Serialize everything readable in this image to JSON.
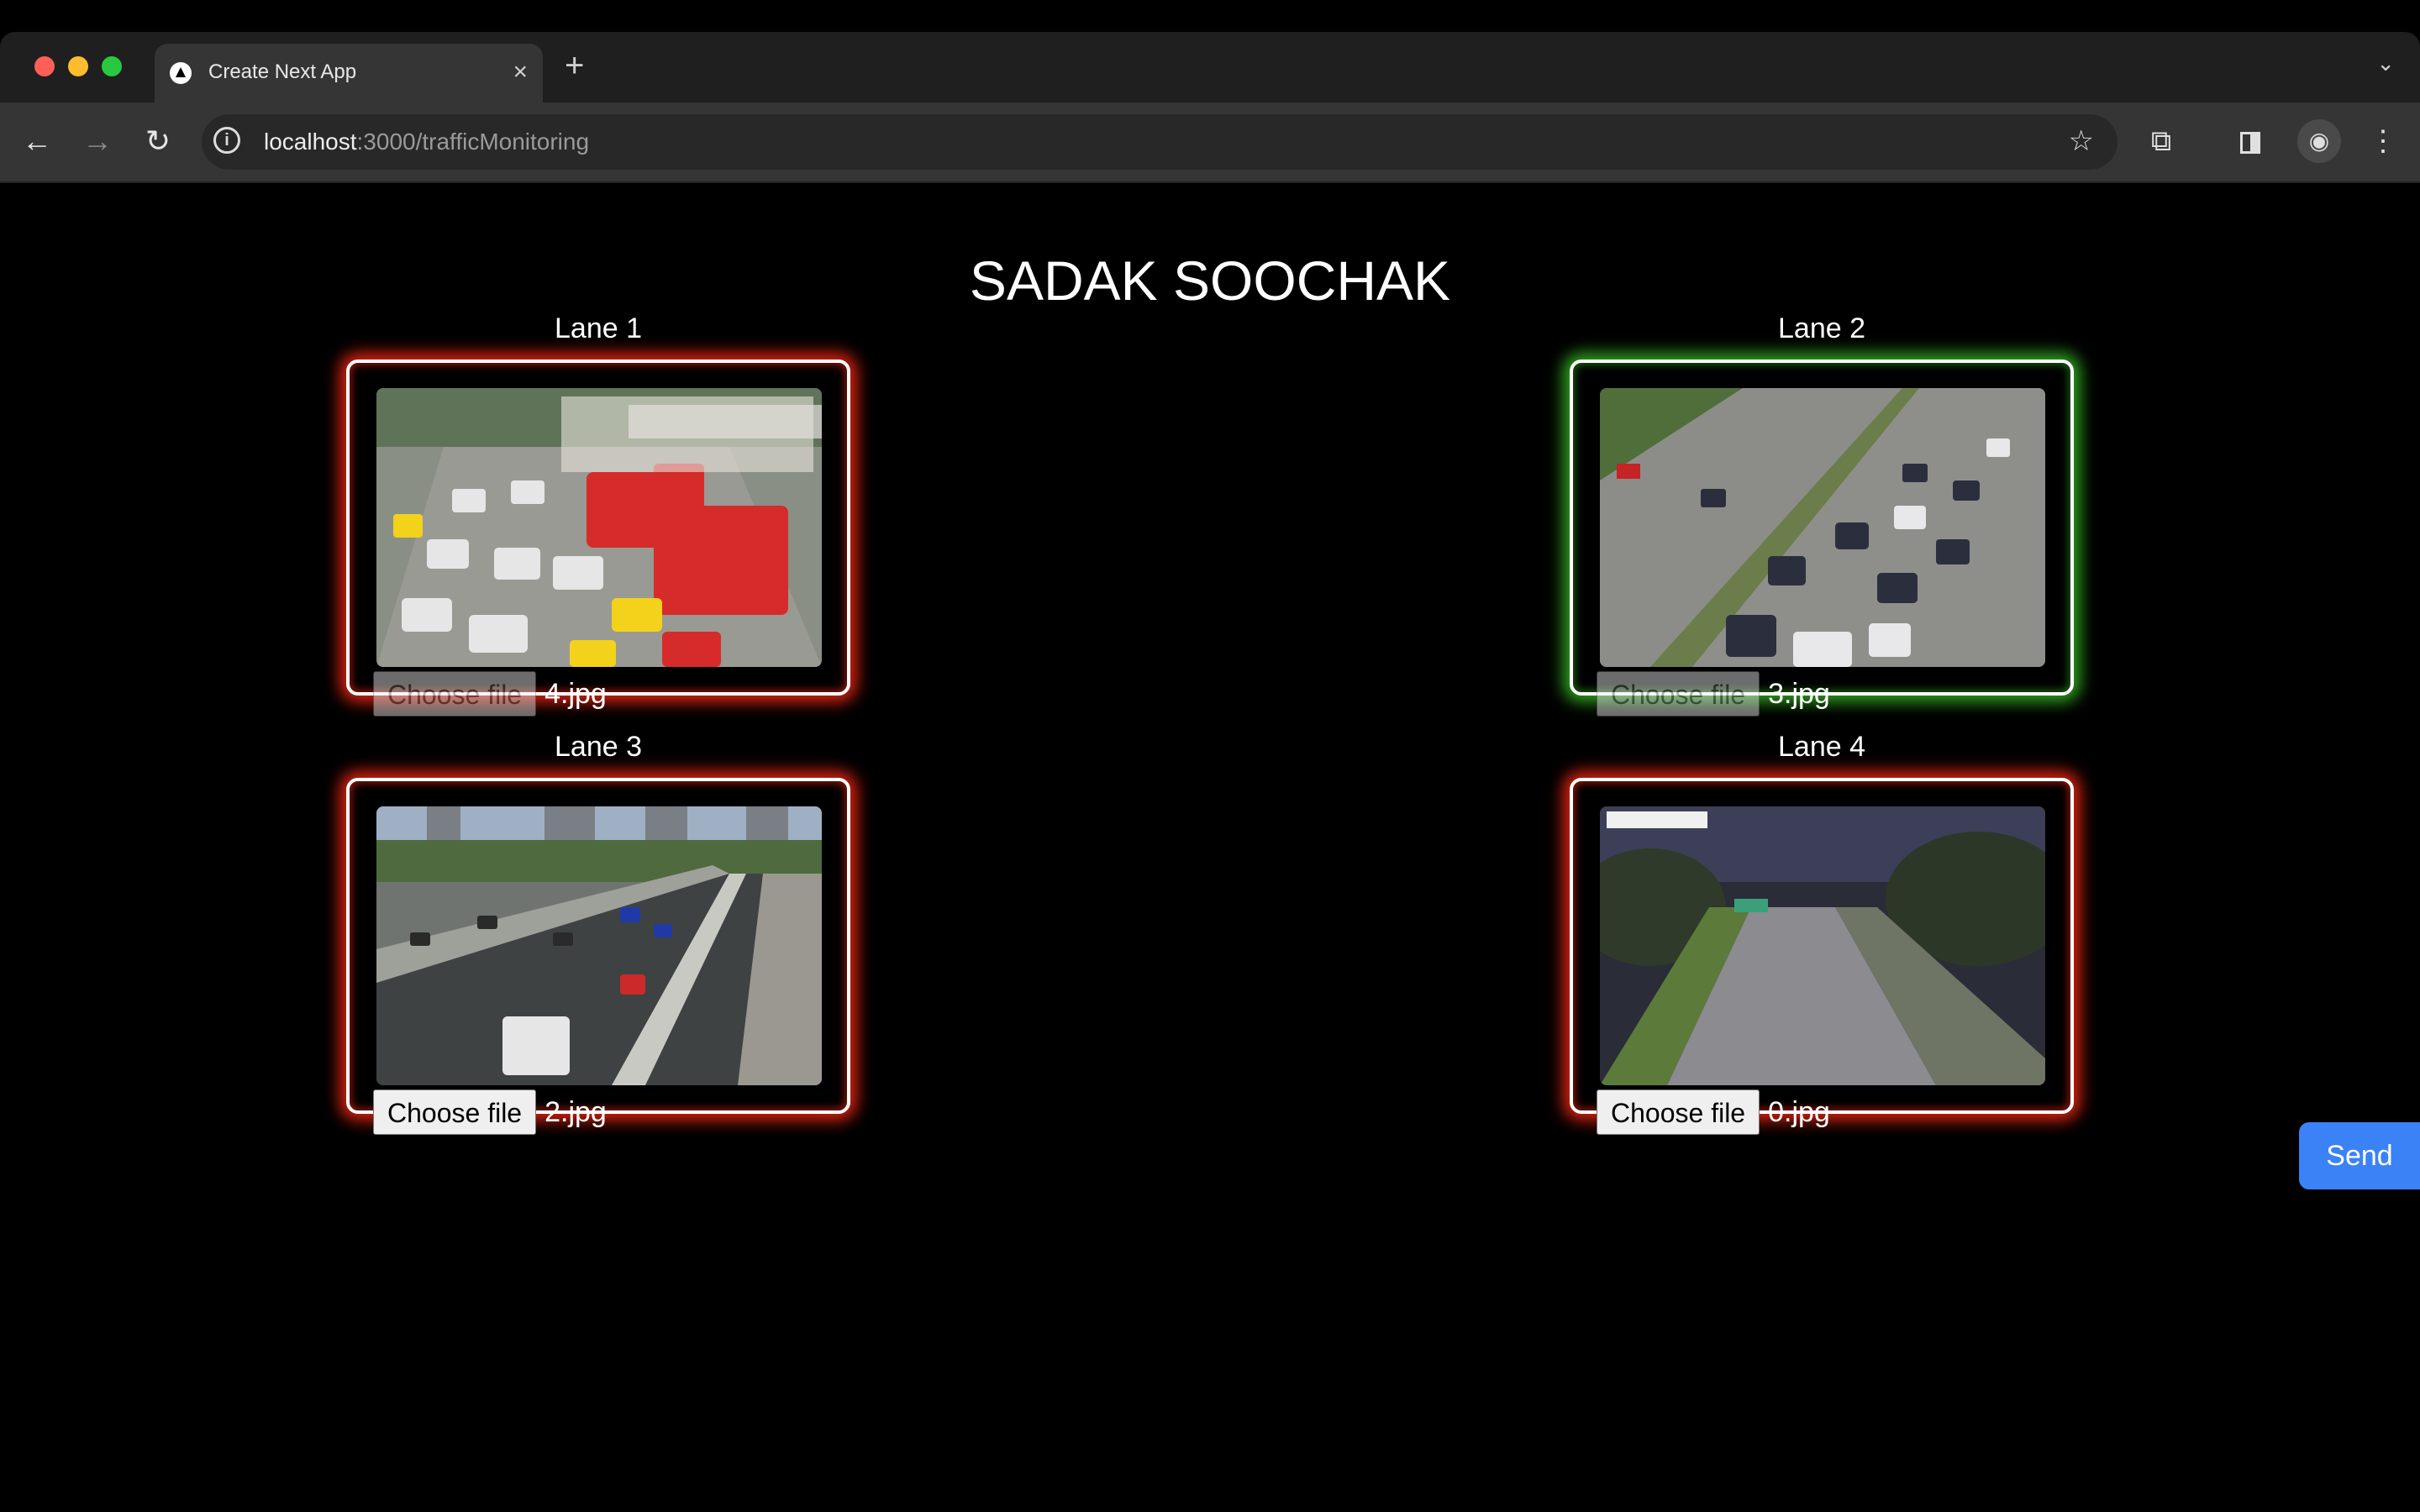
{
  "browser": {
    "tab_title": "Create Next App",
    "tab_close": "×",
    "new_tab": "+",
    "url_host": "localhost",
    "url_rest": ":3000/trafficMonitoring"
  },
  "page": {
    "title": "SADAK SOOCHAK",
    "send_label": "Send"
  },
  "lanes": [
    {
      "label": "Lane 1",
      "file_button": "Choose file",
      "file_name": "4.jpg",
      "signal": "red",
      "button_state": "dimmed"
    },
    {
      "label": "Lane 2",
      "file_button": "Choose file",
      "file_name": "3.jpg",
      "signal": "green",
      "button_state": "dimmed"
    },
    {
      "label": "Lane 3",
      "file_button": "Choose file",
      "file_name": "2.jpg",
      "signal": "red",
      "button_state": "normal"
    },
    {
      "label": "Lane 4",
      "file_button": "Choose file",
      "file_name": "0.jpg",
      "signal": "red",
      "button_state": "normal"
    }
  ],
  "icons": [
    "back-icon",
    "forward-icon",
    "reload-icon",
    "site-info-icon",
    "bookmark-star-icon",
    "extensions-icon",
    "side-panel-icon",
    "profile-icon",
    "menu-icon",
    "tab-favicon",
    "tab-list-chevron-icon"
  ],
  "colors": {
    "signal_red": "#ff2814",
    "signal_green": "#3cc828",
    "send_button": "#3b82f6"
  }
}
